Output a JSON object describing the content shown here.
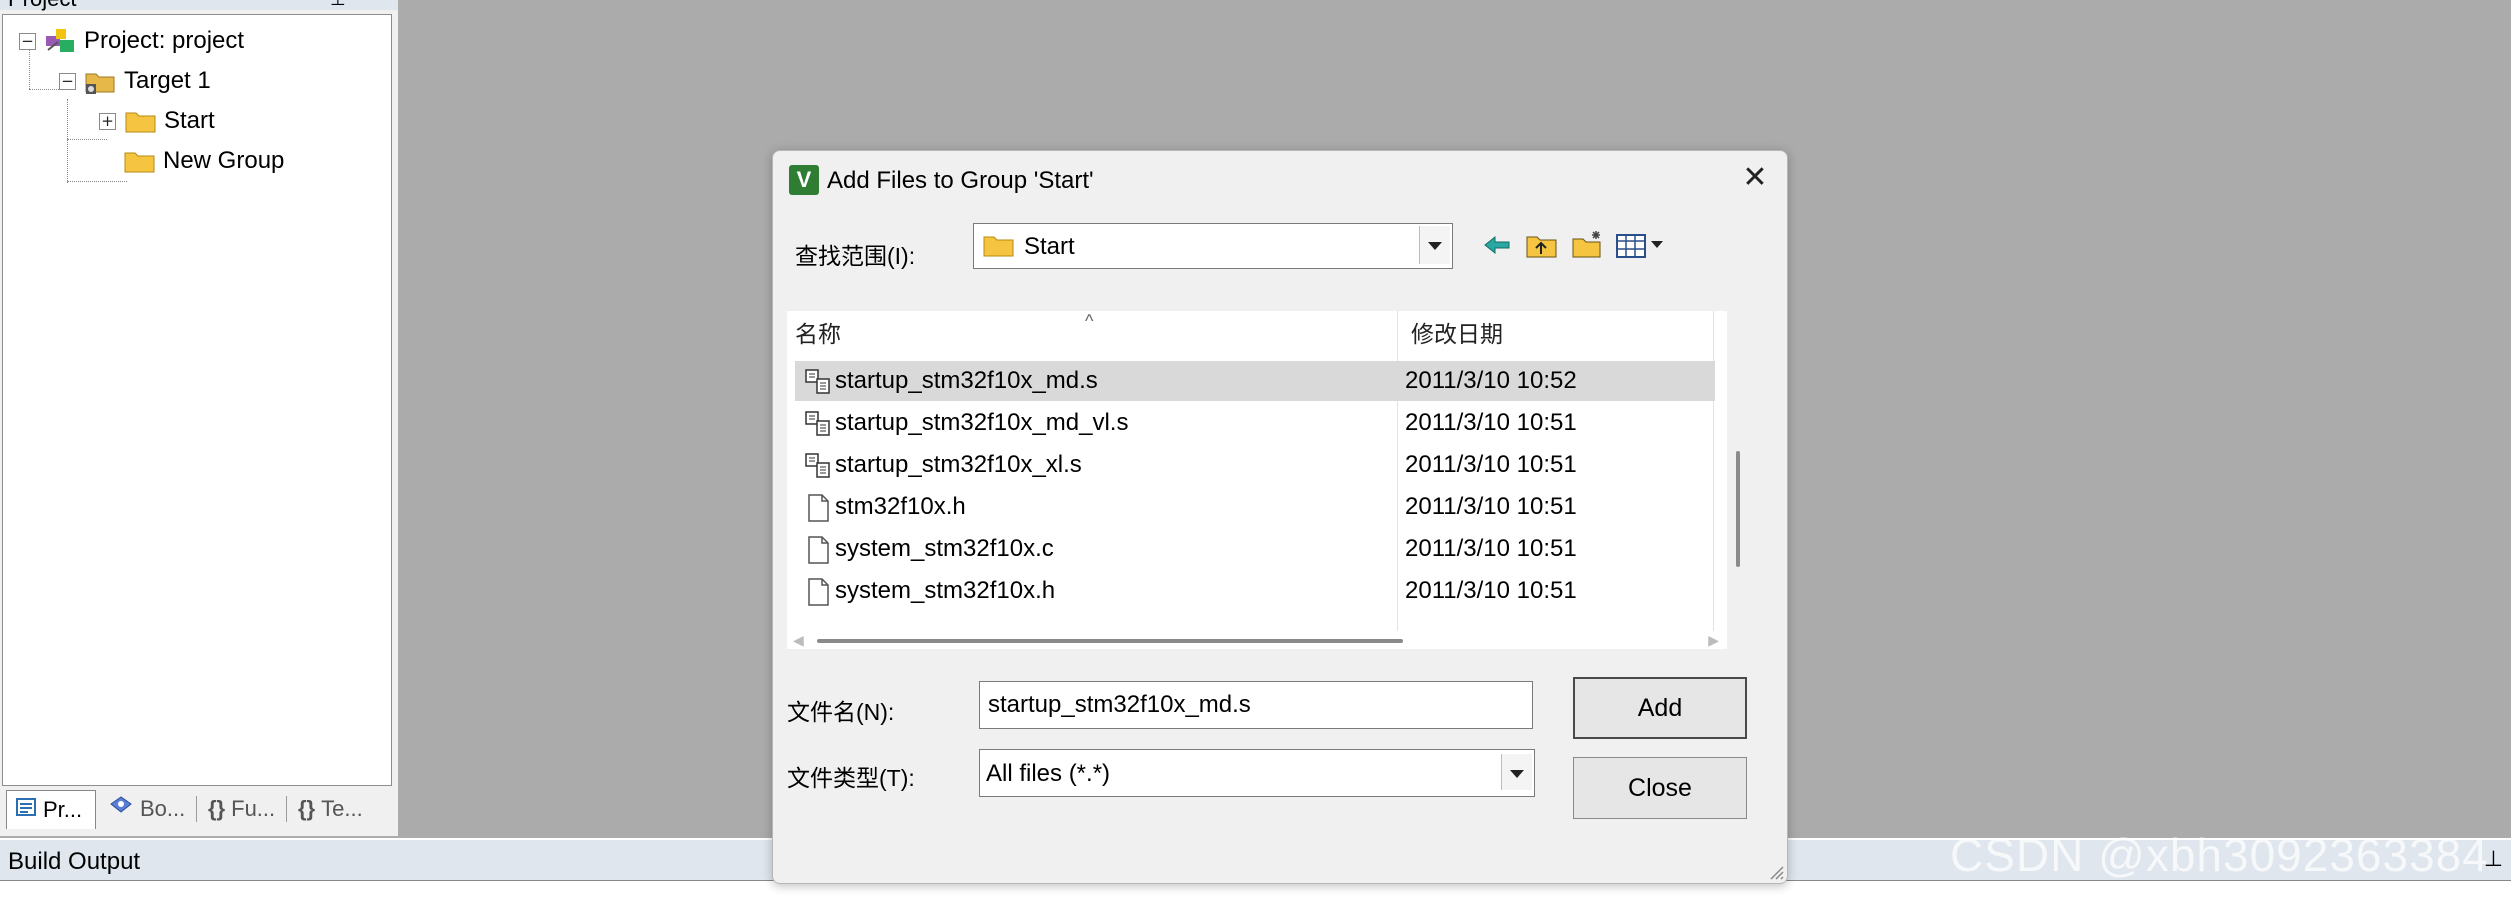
{
  "project_pane": {
    "title": "Project",
    "pin_glyph": "⊥",
    "tree": {
      "root": "Project: project",
      "target": "Target 1",
      "groups": [
        "Start",
        "New Group"
      ]
    },
    "tabs": [
      {
        "icon": "project-icon",
        "label": "Pr..."
      },
      {
        "icon": "books-icon",
        "label": "Bo..."
      },
      {
        "icon": "{}",
        "label": "Fu..."
      },
      {
        "icon": "{}",
        "label": "Te..."
      }
    ]
  },
  "build_output": {
    "label": "Build Output",
    "pin_glyph": "⊥"
  },
  "watermark": "CSDN @xbh3092363384",
  "dialog": {
    "icon_letter": "V",
    "title": "Add Files to Group 'Start'",
    "close_glyph": "✕",
    "look_in_label": "查找范围(I):",
    "look_in_value": "Start",
    "toolbar_icons": [
      "back-arrow-icon",
      "up-folder-icon",
      "new-folder-icon",
      "view-menu-icon"
    ],
    "columns": {
      "name": "名称",
      "date": "修改日期",
      "sort_glyph": "^"
    },
    "files": [
      {
        "name": "startup_stm32f10x_md.s",
        "date": "2011/3/10 10:52",
        "type": "asm",
        "selected": true
      },
      {
        "name": "startup_stm32f10x_md_vl.s",
        "date": "2011/3/10 10:51",
        "type": "asm",
        "selected": false
      },
      {
        "name": "startup_stm32f10x_xl.s",
        "date": "2011/3/10 10:51",
        "type": "asm",
        "selected": false
      },
      {
        "name": "stm32f10x.h",
        "date": "2011/3/10 10:51",
        "type": "file",
        "selected": false
      },
      {
        "name": "system_stm32f10x.c",
        "date": "2011/3/10 10:51",
        "type": "file",
        "selected": false
      },
      {
        "name": "system_stm32f10x.h",
        "date": "2011/3/10 10:51",
        "type": "file",
        "selected": false
      }
    ],
    "filename_label": "文件名(N):",
    "filename_value": "startup_stm32f10x_md.s",
    "filetype_label": "文件类型(T):",
    "filetype_value": "All files (*.*)",
    "add_label": "Add",
    "close_label": "Close"
  },
  "colors": {
    "selection": "#d9d9d9",
    "background": "#ababab",
    "folder": "#f5c542"
  }
}
